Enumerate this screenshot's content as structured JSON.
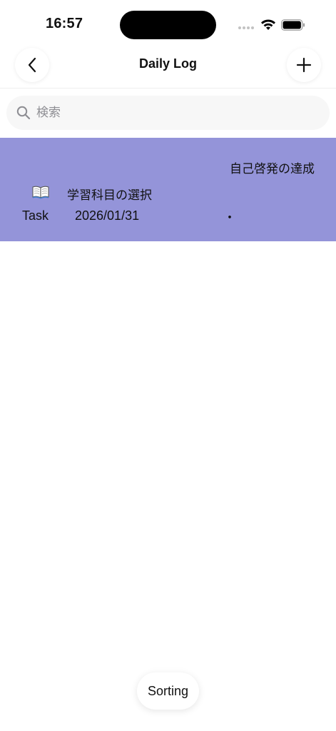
{
  "status_bar": {
    "time": "16:57"
  },
  "nav": {
    "title": "Daily Log",
    "back_icon": "chevron-left-icon",
    "add_icon": "plus-icon"
  },
  "search": {
    "placeholder": "検索",
    "value": ""
  },
  "log_items": [
    {
      "category": "自己啓発の達成",
      "icon": "book-icon",
      "title": "学習科目の選択",
      "type": "Task",
      "date": "2026/01/31",
      "marker": "・",
      "color": "#9494d9"
    }
  ],
  "footer": {
    "sorting_label": "Sorting"
  }
}
